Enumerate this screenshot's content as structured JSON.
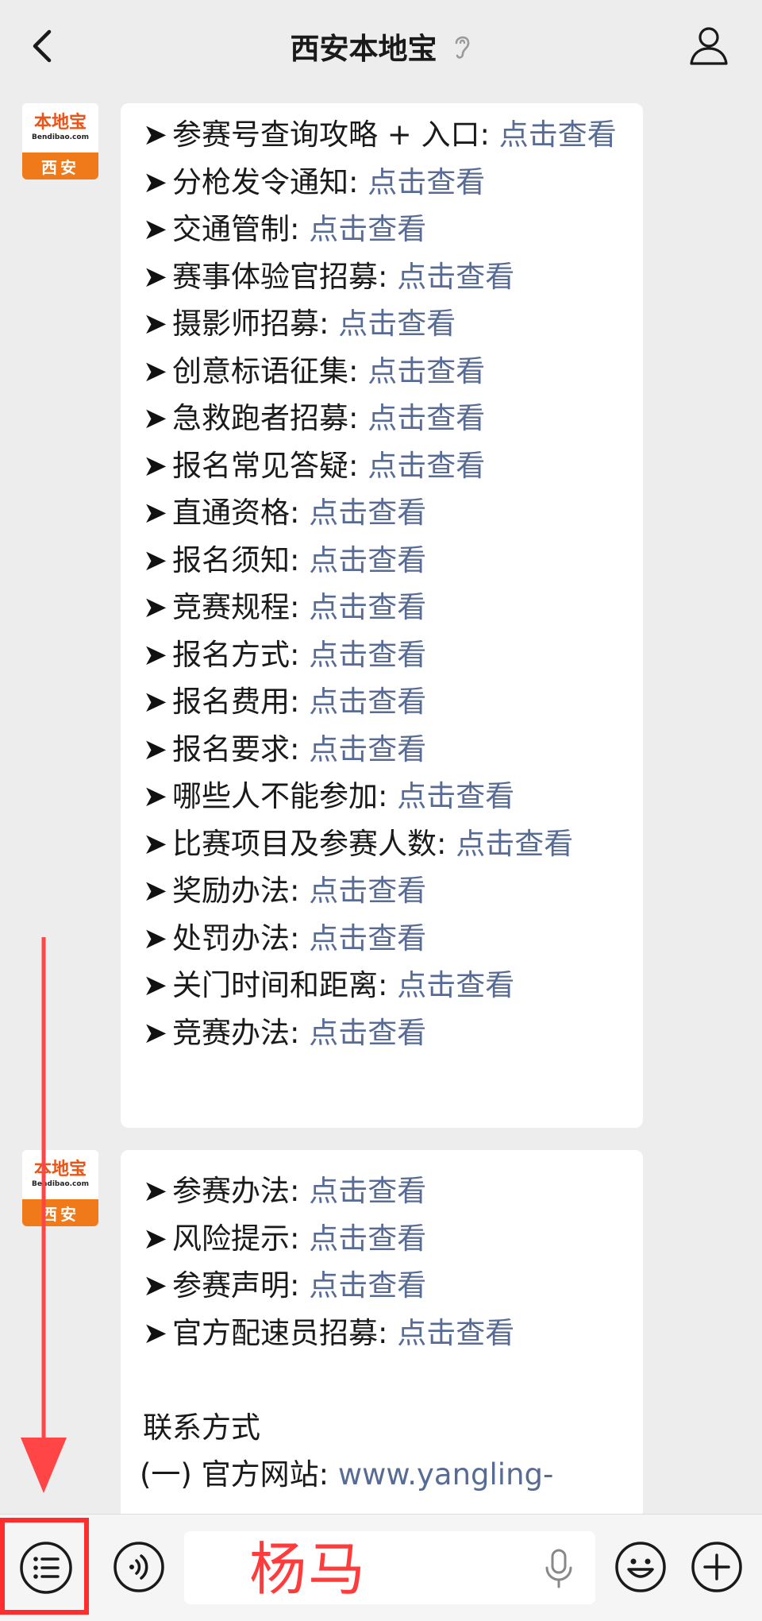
{
  "header": {
    "title": "西安本地宝"
  },
  "avatar": {
    "brand": "本地宝",
    "domain": "Bendibao.com",
    "city": "西安"
  },
  "arrow_glyph": "➤",
  "message1": {
    "first_item": {
      "label": "参赛号查询攻略 + 入口: ",
      "link": "点击查看"
    },
    "items": [
      {
        "label": "分枪发令通知: ",
        "link": "点击查看"
      },
      {
        "label": "交通管制: ",
        "link": "点击查看"
      },
      {
        "label": "赛事体验官招募: ",
        "link": "点击查看"
      },
      {
        "label": "摄影师招募: ",
        "link": "点击查看"
      },
      {
        "label": "创意标语征集: ",
        "link": "点击查看"
      },
      {
        "label": "急救跑者招募: ",
        "link": "点击查看"
      },
      {
        "label": "报名常见答疑: ",
        "link": "点击查看"
      },
      {
        "label": "直通资格: ",
        "link": "点击查看"
      },
      {
        "label": "报名须知: ",
        "link": "点击查看"
      },
      {
        "label": "竞赛规程: ",
        "link": "点击查看"
      },
      {
        "label": "报名方式: ",
        "link": "点击查看"
      },
      {
        "label": "报名费用: ",
        "link": "点击查看"
      },
      {
        "label": "报名要求: ",
        "link": "点击查看"
      },
      {
        "label": "哪些人不能参加: ",
        "link": "点击查看"
      },
      {
        "label": "比赛项目及参赛人数: ",
        "link": "点击查看"
      },
      {
        "label": "奖励办法: ",
        "link": "点击查看"
      },
      {
        "label": "处罚办法: ",
        "link": "点击查看"
      },
      {
        "label": "关门时间和距离: ",
        "link": "点击查看"
      },
      {
        "label": "竞赛办法: ",
        "link": "点击查看"
      }
    ]
  },
  "message2": {
    "items": [
      {
        "label": "参赛办法: ",
        "link": "点击查看"
      },
      {
        "label": "风险提示: ",
        "link": "点击查看"
      },
      {
        "label": "参赛声明: ",
        "link": "点击查看"
      },
      {
        "label": "官方配速员招募: ",
        "link": "点击查看"
      }
    ],
    "contact_heading": "联系方式",
    "website_label": "(一) 官方网站: ",
    "website_link": "www.yangling-"
  },
  "input": {
    "text": "杨马"
  },
  "colors": {
    "link": "#576b95",
    "annotation_red": "#ff2d2d",
    "avatar_orange": "#f07a19"
  },
  "icons": {
    "back": "back-arrow-icon",
    "ear": "ear-icon",
    "profile": "profile-icon",
    "menu": "menu-list-icon",
    "voice": "voice-icon",
    "mic": "microphone-icon",
    "emoji": "emoji-icon",
    "plus": "plus-icon"
  }
}
